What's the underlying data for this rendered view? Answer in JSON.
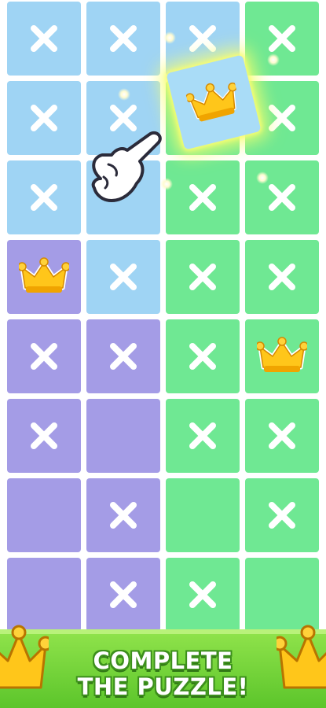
{
  "banner": {
    "line1": "COMPLETE",
    "line2": "THE PUZZLE!"
  },
  "colors": {
    "blue": "#9fd4f4",
    "green": "#6fe893",
    "purple": "#a49ce6",
    "crown_gold": "#ffc61a",
    "banner_green": "#6fd232"
  },
  "grid": {
    "rows": [
      [
        {
          "c": "blue",
          "m": "x"
        },
        {
          "c": "blue",
          "m": "x"
        },
        {
          "c": "blue",
          "m": "x"
        },
        {
          "c": "green",
          "m": "x"
        }
      ],
      [
        {
          "c": "blue",
          "m": "x"
        },
        {
          "c": "blue",
          "m": "x"
        },
        {
          "c": "green",
          "m": "empty"
        },
        {
          "c": "green",
          "m": "x"
        }
      ],
      [
        {
          "c": "blue",
          "m": "x"
        },
        {
          "c": "blue",
          "m": "empty"
        },
        {
          "c": "green",
          "m": "x"
        },
        {
          "c": "green",
          "m": "x"
        }
      ],
      [
        {
          "c": "purple",
          "m": "crown"
        },
        {
          "c": "blue",
          "m": "x"
        },
        {
          "c": "green",
          "m": "x"
        },
        {
          "c": "green",
          "m": "x"
        }
      ],
      [
        {
          "c": "purple",
          "m": "x"
        },
        {
          "c": "purple",
          "m": "x"
        },
        {
          "c": "green",
          "m": "x"
        },
        {
          "c": "green",
          "m": "crown"
        }
      ],
      [
        {
          "c": "purple",
          "m": "x"
        },
        {
          "c": "purple",
          "m": "empty"
        },
        {
          "c": "green",
          "m": "x"
        },
        {
          "c": "green",
          "m": "x"
        }
      ],
      [
        {
          "c": "purple",
          "m": "empty"
        },
        {
          "c": "purple",
          "m": "x"
        },
        {
          "c": "green",
          "m": "empty"
        },
        {
          "c": "green",
          "m": "x"
        }
      ],
      [
        {
          "c": "purple",
          "m": "empty"
        },
        {
          "c": "purple",
          "m": "x"
        },
        {
          "c": "green",
          "m": "x"
        },
        {
          "c": "green",
          "m": "empty"
        }
      ]
    ]
  },
  "lifted_tile": {
    "mark": "crown"
  },
  "icons": {
    "cross": "x-mark-icon",
    "crown": "crown-icon",
    "pointer": "pointing-hand-icon"
  }
}
